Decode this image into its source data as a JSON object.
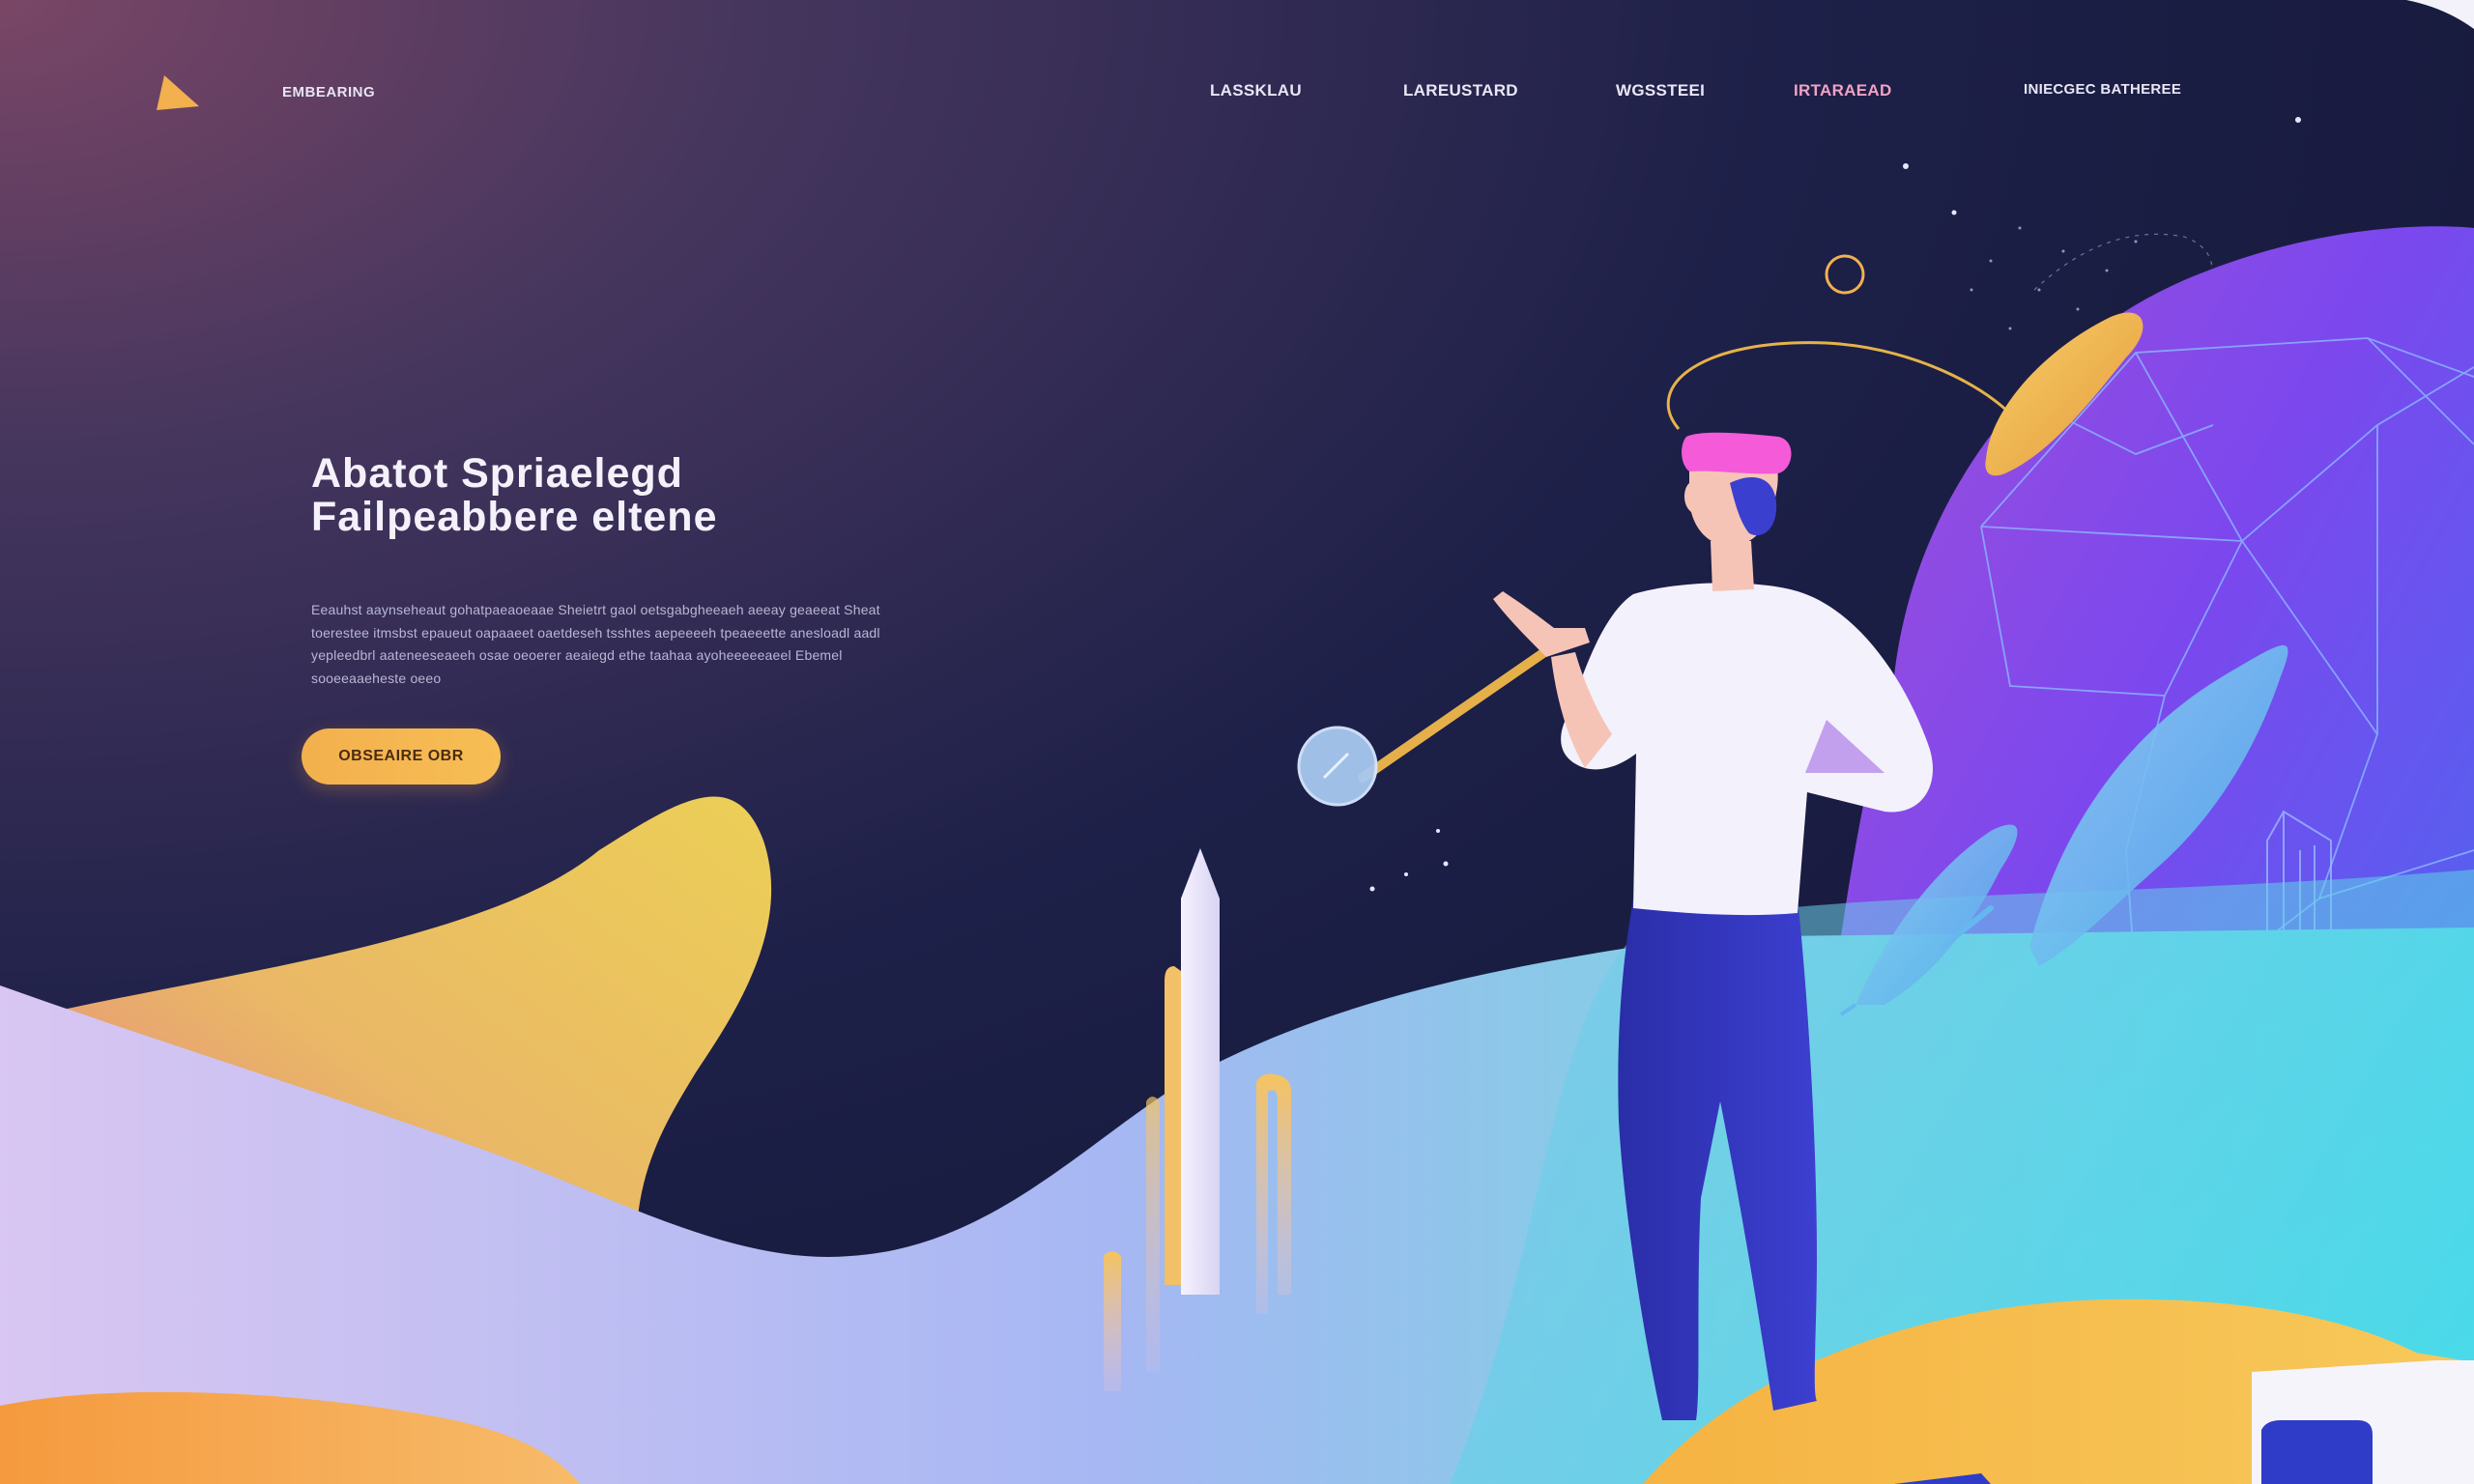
{
  "brand": {
    "name": "EMBEARING"
  },
  "nav": {
    "links": [
      {
        "label": "LASSKLAU"
      },
      {
        "label": "LAREUSTARD"
      },
      {
        "label": "WGSSTEEI"
      },
      {
        "label": "IRTARAEAD"
      },
      {
        "label": "INIECGEC BATHEREE"
      }
    ]
  },
  "hero": {
    "title_line1": "Abatot  Spriaelegd",
    "title_line2": "Failpeabbere eltene",
    "description": "Eeauhst aaynseheaut gohatpaeaoeaae Sheietrt gaol oetsgabgheeaeh aeeay geaeeat Sheat toerestee itmsbst epaueut oapaaeet oaetdeseh tsshtes aepeeeeh tpeaeeette anesloadl aadl yepleedbrl aateneeseaeeh osae oeoerer aeaiegd ethe taahaa ayoheeeeeaeel Ebemel sooeeaaeheste oeeo",
    "cta_label": "OBSEAIRE OBR"
  },
  "colors": {
    "accent": "#f5b24f",
    "background_top": "#2b2d5a",
    "background_deep": "#171a3d",
    "planet": "#7b4ff0",
    "hair": "#f55ad8"
  },
  "icons": {
    "logo": "triangle-logo-icon"
  }
}
